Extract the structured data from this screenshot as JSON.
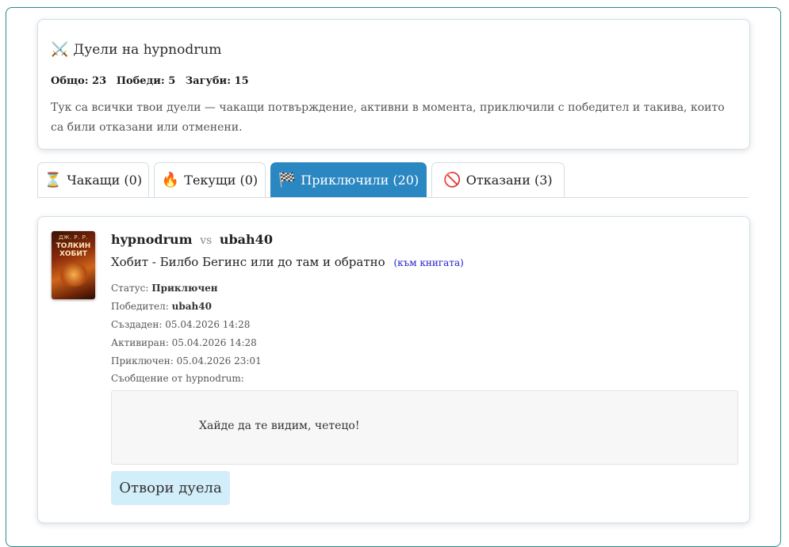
{
  "summary": {
    "title_icon": "crossed-swords-icon",
    "title": "Дуели на hypnodrum",
    "stats": {
      "total": "Общо: 23",
      "wins": "Победи: 5",
      "losses": "Загуби: 15"
    },
    "description": "Тук са всички твои дуели — чакащи потвърждение, активни в момента, приключили с победител и такива, които са били отказани или отменени."
  },
  "tabs": [
    {
      "icon": "⏳",
      "icon_name": "hourglass-icon",
      "label": "Чакащи (0)",
      "active": false
    },
    {
      "icon": "🔥",
      "icon_name": "fire-icon",
      "label": "Текущи (0)",
      "active": false
    },
    {
      "icon": "🏁",
      "icon_name": "checkered-flag-icon",
      "label": "Приключили (20)",
      "active": true
    },
    {
      "icon": "🚫",
      "icon_name": "prohibited-icon",
      "label": "Отказани (3)",
      "active": false
    }
  ],
  "duel": {
    "cover": {
      "author": "ДЖ. Р. Р.",
      "title": "ТОЛКИН ХОБИТ"
    },
    "player1": "hypnodrum",
    "vs": "vs",
    "player2": "ubah40",
    "book_title": "Хобит - Билбо Бегинс или до там и обратно",
    "book_link": "(към книгата)",
    "status_label": "Статус:",
    "status_value": "Приключен",
    "winner_label": "Победител:",
    "winner_value": "ubah40",
    "created": "Създаден: 05.04.2026 14:28",
    "activated": "Активиран: 05.04.2026 14:28",
    "finished": "Приключен: 05.04.2026 23:01",
    "message_label": "Съобщение от hypnodrum:",
    "message": "Хайде да те видим, четецо!",
    "open_button": "Отвори дуела"
  },
  "colors": {
    "accent": "#2b87c2",
    "button_bg": "#d2eefa",
    "link": "#2323c9"
  }
}
